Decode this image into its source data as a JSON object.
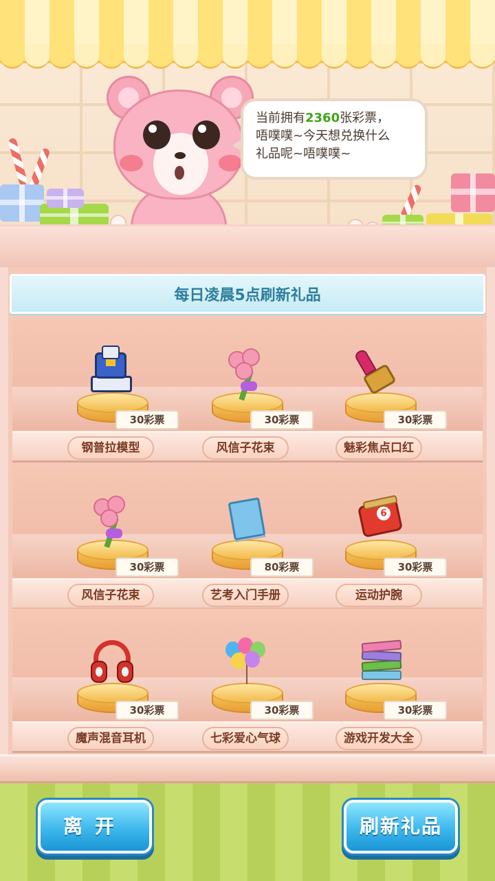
{
  "speech": {
    "prefix": "当前拥有",
    "ticket_count": "2360",
    "suffix": "张彩票，",
    "line2": "唔噗噗~今天想兑换什么",
    "line3": "礼品呢~唔噗噗~"
  },
  "shelf": {
    "title": "每日凌晨5点刷新礼品",
    "items": [
      {
        "name": "钢普拉模型",
        "price": "30彩票",
        "icon": "robot-model-icon"
      },
      {
        "name": "风信子花束",
        "price": "30彩票",
        "icon": "flower-bouquet-icon"
      },
      {
        "name": "魅彩焦点口红",
        "price": "30彩票",
        "icon": "lipstick-icon"
      },
      {
        "name": "风信子花束",
        "price": "30彩票",
        "icon": "flower-bouquet-icon"
      },
      {
        "name": "艺考入门手册",
        "price": "80彩票",
        "icon": "handbook-icon"
      },
      {
        "name": "运动护腕",
        "price": "30彩票",
        "icon": "wristband-icon"
      },
      {
        "name": "魔声混音耳机",
        "price": "30彩票",
        "icon": "headphones-icon"
      },
      {
        "name": "七彩爱心气球",
        "price": "30彩票",
        "icon": "heart-balloons-icon"
      },
      {
        "name": "游戏开发大全",
        "price": "30彩票",
        "icon": "book-stack-icon"
      }
    ]
  },
  "buttons": {
    "leave": "离开",
    "refresh": "刷新礼品"
  },
  "colors": {
    "ticket_count": "#3fa51b",
    "header_text": "#2d7e9c",
    "button_blue": "#3eb7ec"
  }
}
